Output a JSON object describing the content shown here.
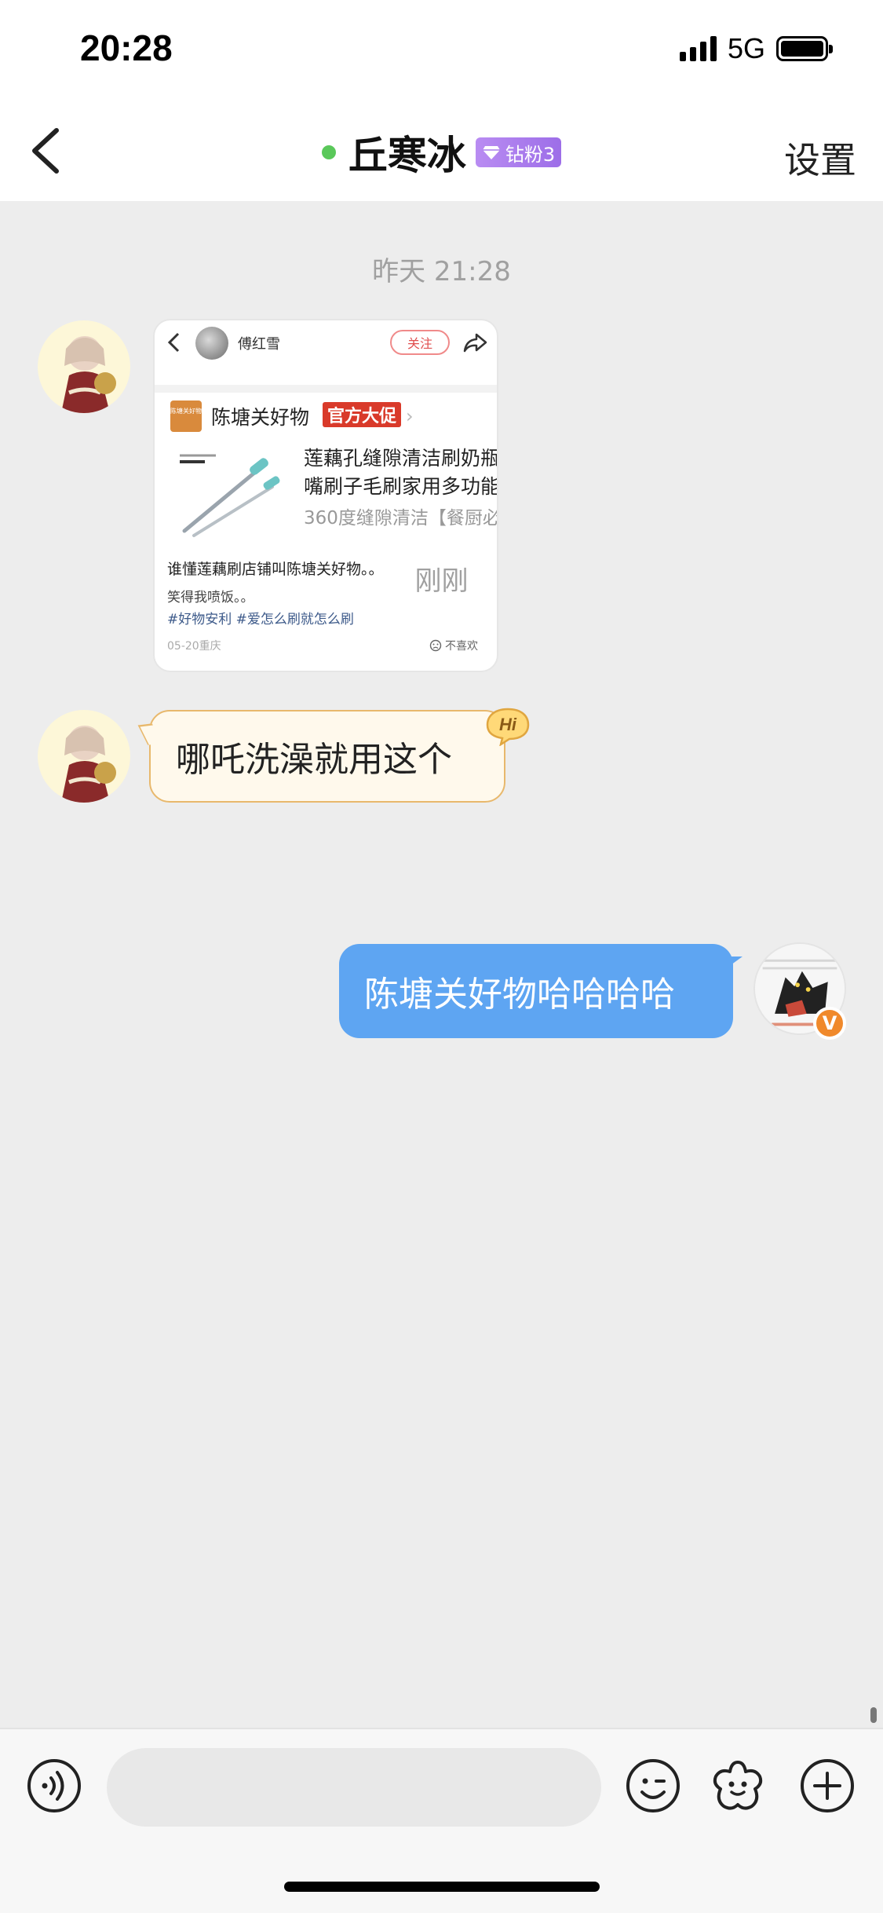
{
  "status_bar": {
    "time": "20:28",
    "network": "5G"
  },
  "nav": {
    "back_icon": "chevron-left-icon",
    "title": "丘寒冰",
    "online": true,
    "badge_label": "钻粉3",
    "badge_icon": "diamond-icon",
    "settings_label": "设置"
  },
  "messages": {
    "timestamp_1": "昨天 21:28",
    "shared_post": {
      "author": "傅红雪",
      "follow_label": "关注",
      "shop_logo_text": "陈塘关好物",
      "shop_name": "陈塘关好物",
      "shop_tag": "官方大促",
      "product_title_line1": "莲藕孔缝隙清洁刷奶瓶",
      "product_title_line2": "嘴刷子毛刷家用多功能",
      "product_subtitle": "360度缝隙清洁【餐厨必",
      "caption": "谁懂莲藕刷店铺叫陈塘关好物。。",
      "line2": "笑得我喷饭。。",
      "tags": "#好物安利 #爱怎么刷就怎么刷",
      "date": "05-20重庆",
      "dislike_label": "不喜欢"
    },
    "incoming_text": "哪吒洗澡就用这个",
    "hi_sticker": "Hi",
    "timestamp_2": "刚刚",
    "outgoing_text": "陈塘关好物哈哈哈哈",
    "verified_mark": "V"
  },
  "input_bar": {
    "placeholder": "",
    "icons": [
      "voice-icon",
      "emoji-icon",
      "sticker-icon",
      "plus-icon"
    ]
  },
  "colors": {
    "background": "#ededed",
    "outgoing_bubble": "#5ea5f2",
    "incoming_bubble": "#fff9ec",
    "incoming_border": "#e8b86c",
    "online_dot": "#5ac85a",
    "badge": "#a97cec",
    "shop_tag": "#d93a2a",
    "verified": "#f0892b"
  }
}
